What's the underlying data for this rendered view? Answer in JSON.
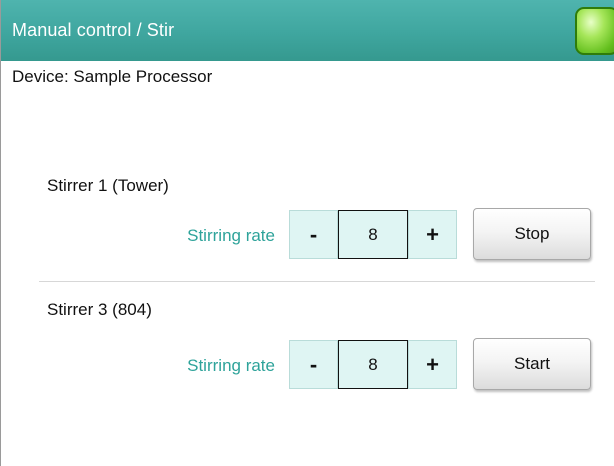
{
  "header": {
    "title": "Manual control / Stir",
    "status_icon": "green-status-led",
    "status_color": "#64bf1e"
  },
  "device": {
    "label": "Device: Sample Processor"
  },
  "stirrers": [
    {
      "title": "Stirrer 1 (Tower)",
      "rate_label": "Stirring rate",
      "decrement_label": "-",
      "value": "8",
      "increment_label": "+",
      "action_label": "Stop"
    },
    {
      "title": "Stirrer 3 (804)",
      "rate_label": "Stirring rate",
      "decrement_label": "-",
      "value": "8",
      "increment_label": "+",
      "action_label": "Start"
    }
  ],
  "colors": {
    "titlebar": "#3fa69f",
    "accent_text": "#2ea39a",
    "field_background": "#dff5f3"
  }
}
